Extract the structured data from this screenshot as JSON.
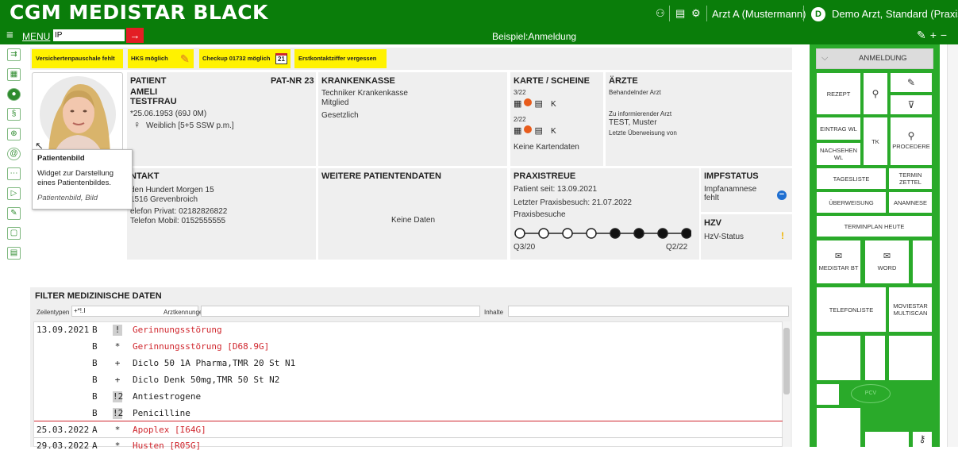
{
  "titlebar": {
    "logo": "CGM MEDISTAR BLACK",
    "user_a": "Arzt A (Mustermann)",
    "avatar_letter": "D",
    "user_demo": "Demo  Arzt, Standard (Praxis)"
  },
  "menubar": {
    "menu_label": "MENU",
    "input_value": "IP",
    "title": "Beispiel:Anmeldung",
    "right_icons": "✎+−"
  },
  "alerts": [
    {
      "label": "Versichertenpauschale fehlt"
    },
    {
      "label": "HKS möglich"
    },
    {
      "label": "Checkup 01732 möglich"
    },
    {
      "label": "Erstkontaktziffer vergessen"
    }
  ],
  "checkup_calendar": "21",
  "tooltip": {
    "title": "Patientenbild",
    "desc": "Widget zur Darstellung eines Patientenbildes.",
    "tags": "Patientenbild, Bild"
  },
  "patient": {
    "header": "PATIENT",
    "patnr": "PAT-NR 23",
    "firstname": "AMELI",
    "lastname": "TESTFRAU",
    "dob": "*25.06.1953 (69J 0M)",
    "sex": "Weiblich [5+5 SSW p.m.]"
  },
  "krankenkasse": {
    "header": "KRANKENKASSE",
    "line1": "Techniker Krankenkasse",
    "line2": "Mitglied",
    "line3": "Gesetzlich"
  },
  "karte": {
    "header": "KARTE / SCHEINE",
    "q1": "3/22",
    "q2": "2/22",
    "k": "K",
    "none": "Keine Kartendaten"
  },
  "aerzte": {
    "header": "ÄRZTE",
    "label1": "Behandelnder Arzt",
    "label2": "Zu informierender Arzt",
    "value2": "TEST, Muster",
    "label3": "Letzte Überweisung von"
  },
  "kontakt": {
    "header": "KONTAKT",
    "header_visible": "NTAKT",
    "addr1": "Am den Hundert Morgen 15",
    "addr1_visible": "den Hundert Morgen 15",
    "addr2": "41516 Grevenbroich",
    "addr2_visible": "1516 Grevenbroich",
    "phone1": "Telefon Privat: 02182826822",
    "phone1_visible": "elefon Privat: 02182826822",
    "phone2": "Telefon Mobil: 0152555555"
  },
  "weitere": {
    "header": "WEITERE PATIENTENDATEN",
    "none": "Keine Daten"
  },
  "praxistreue": {
    "header": "PRAXISTREUE",
    "since": "Patient seit: 13.09.2021",
    "last": "Letzter Praxisbesuch: 21.07.2022",
    "visits_label": "Praxisbesuche",
    "start": "Q3/20",
    "end": "Q2/22",
    "visits": [
      0,
      0,
      0,
      0,
      1,
      1,
      1,
      1
    ]
  },
  "impfstatus": {
    "header": "IMPFSTATUS",
    "text1": "Impfanamnese",
    "text2": "fehlt"
  },
  "hzv": {
    "header": "HZV",
    "status": "HzV-Status",
    "mark": "!"
  },
  "filter": {
    "header": "FILTER MEDIZINISCHE DATEN",
    "zeilentypen_label": "Zeilentypen",
    "zeilentypen_value": "+*!.I",
    "arzt_label": "Arztkennungen",
    "inhalte_label": "Inhalte"
  },
  "rows": [
    {
      "date": "13.09.2021",
      "type": "B",
      "mark": "!",
      "text": "Gerinnungsstörung",
      "red": true
    },
    {
      "date": "",
      "type": "B",
      "mark": "*",
      "text": "Gerinnungsstörung [D68.9G]",
      "red": true
    },
    {
      "date": "",
      "type": "B",
      "mark": "+",
      "text": "Diclo 50 1A Pharma,TMR 20 St N1",
      "red": false
    },
    {
      "date": "",
      "type": "B",
      "mark": "+",
      "text": "Diclo Denk 50mg,TMR 50 St N2",
      "red": false
    },
    {
      "date": "",
      "type": "B",
      "mark": "!2",
      "text": "Antiestrogene",
      "red": false
    },
    {
      "date": "",
      "type": "B",
      "mark": "!2",
      "text": "Penicilline",
      "red": false
    },
    {
      "date": "25.03.2022",
      "type": "A",
      "mark": "*",
      "text": "Apoplex [I64G]",
      "red": true
    },
    {
      "date": "29.03.2022",
      "type": "A",
      "mark": "*",
      "text": "Husten [R05G]",
      "red": true
    }
  ],
  "rightpanel": {
    "anmeldung": "ANMELDUNG",
    "rezept": "REZEPT",
    "eintrag_wl": "EINTRAG WL",
    "tk": "TK",
    "nachsehen_wl": "NACHSEHEN WL",
    "procedere": "PROCEDERE",
    "tagesliste": "TAGESLISTE",
    "terminzettel": "TERMIN ZETTEL",
    "ueberweisung": "ÜBERWEISUNG",
    "anamnese": "ANAMNESE",
    "terminplan": "TERMINPLAN HEUTE",
    "medistar_bt": "MEDISTAR BT",
    "word": "WORD",
    "telefonliste": "TELEFONLISTE",
    "moviestar": "MOVIESTAR MULTISCAN",
    "pcv": "PCV"
  },
  "colors": {
    "brand_green": "#0a7d0a",
    "panel_green": "#2aaa2a",
    "alert_yellow": "#fff200",
    "alert_red": "#d0272e"
  }
}
